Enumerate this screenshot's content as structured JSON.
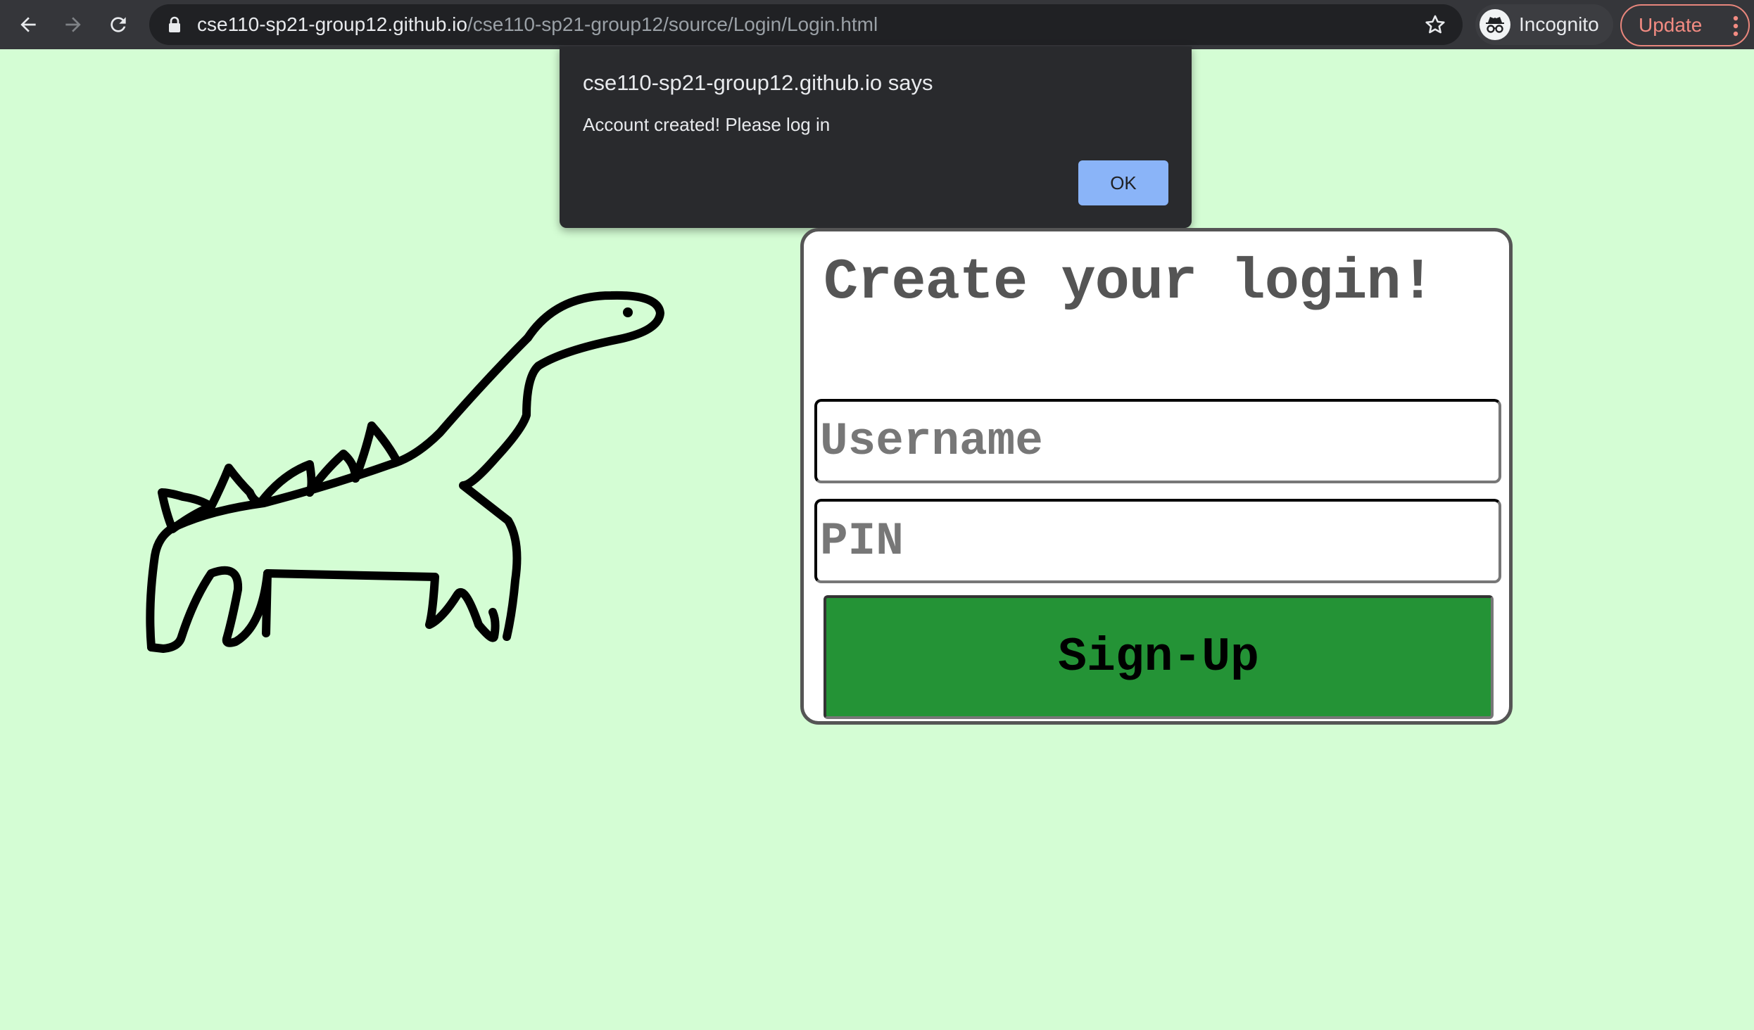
{
  "browser": {
    "url_host": "cse110-sp21-group12.github.io",
    "url_path": "/cse110-sp21-group12/source/Login/Login.html",
    "incognito_label": "Incognito",
    "update_label": "Update",
    "icons": [
      "back-arrow-icon",
      "forward-arrow-icon",
      "reload-icon",
      "lock-icon",
      "star-icon",
      "incognito-icon",
      "more-vert-icon"
    ]
  },
  "dialog": {
    "title": "cse110-sp21-group12.github.io says",
    "message": "Account created! Please log in",
    "ok_label": "OK"
  },
  "login": {
    "title": "Create your login!",
    "username_placeholder": "Username",
    "pin_placeholder": "PIN",
    "signup_label": "Sign-Up"
  },
  "colors": {
    "page_background": "#d4fdd4",
    "signup_button": "#249336",
    "dialog_background": "#292a2d",
    "ok_button": "#8ab4f8",
    "update_accent": "#f28b82"
  }
}
